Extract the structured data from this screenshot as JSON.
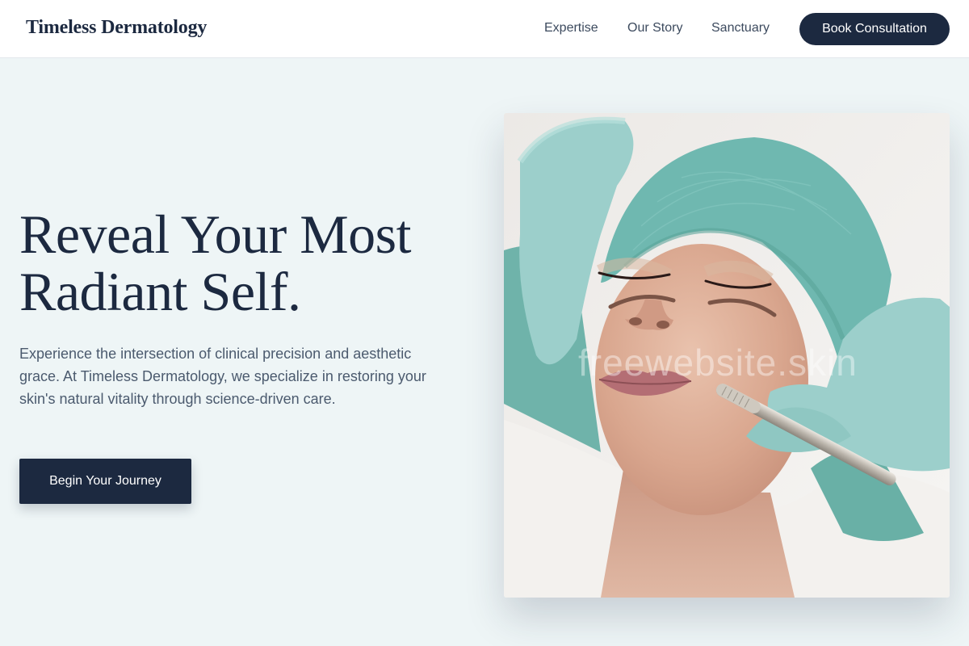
{
  "header": {
    "brand": "Timeless Dermatology",
    "nav": {
      "expertise": "Expertise",
      "story": "Our Story",
      "sanctuary": "Sanctuary"
    },
    "cta": "Book Consultation"
  },
  "hero": {
    "title_line1": "Reveal Your Most",
    "title_line2": "Radiant Self.",
    "description": "Experience the intersection of clinical precision and aesthetic grace. At Timeless Dermatology, we specialize in restoring your skin's natural vitality through science-driven care.",
    "cta": "Begin Your Journey",
    "image": {
      "alt": "Woman receiving a facial skin treatment with gloved hands and a metal tool",
      "watermark": "freewebsite.skin"
    }
  },
  "colors": {
    "page_bg": "#eef5f6",
    "navy": "#1c2940",
    "glove": "#9ccfcb",
    "cap": "#6fb8b0"
  }
}
